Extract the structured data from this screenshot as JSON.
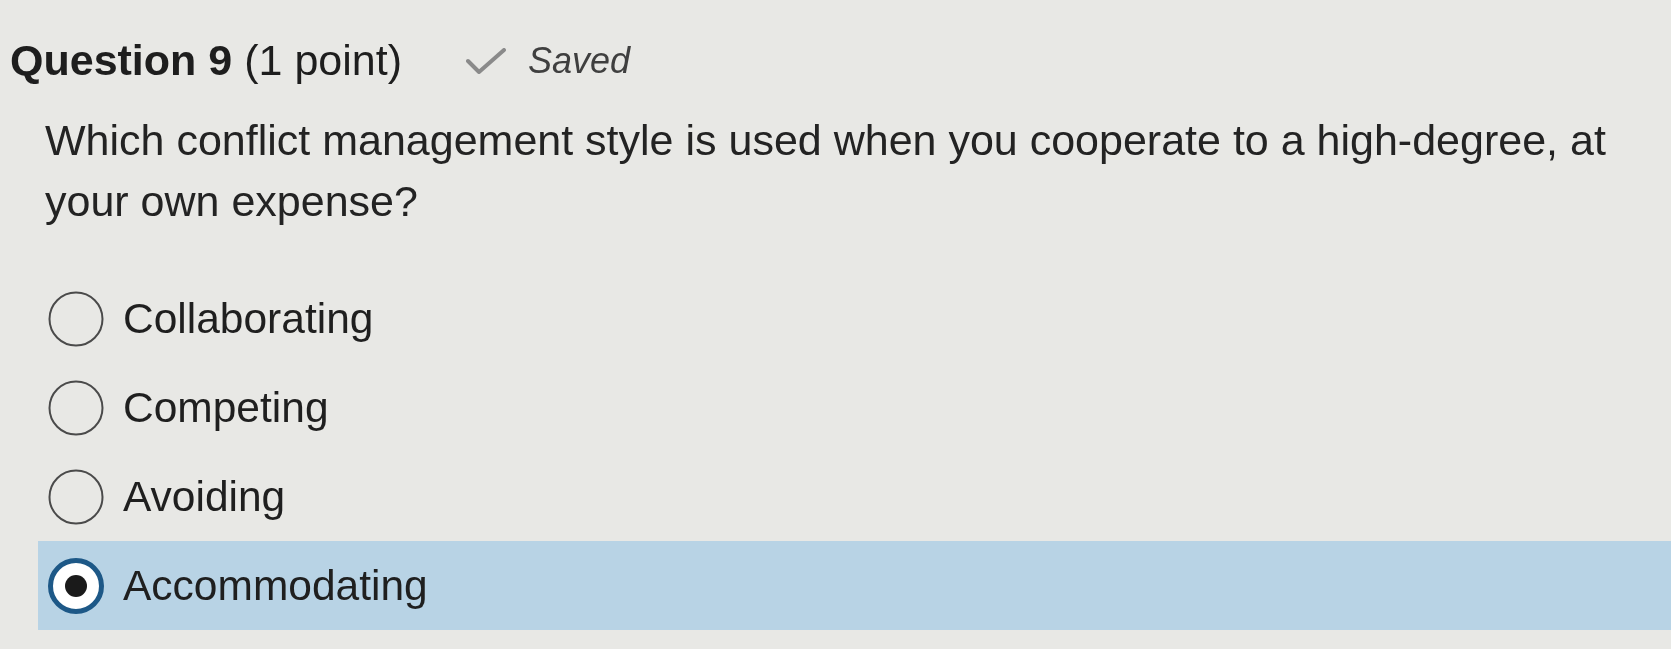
{
  "question": {
    "title": "Question 9",
    "points": "(1 point)",
    "save_status": {
      "saved": true,
      "label": "Saved"
    },
    "prompt": "Which conflict management style is used when you cooperate to a high-degree, at your own expense?"
  },
  "options": [
    {
      "label": "Collaborating",
      "selected": false
    },
    {
      "label": "Competing",
      "selected": false
    },
    {
      "label": "Avoiding",
      "selected": false
    },
    {
      "label": "Accommodating",
      "selected": true
    }
  ]
}
